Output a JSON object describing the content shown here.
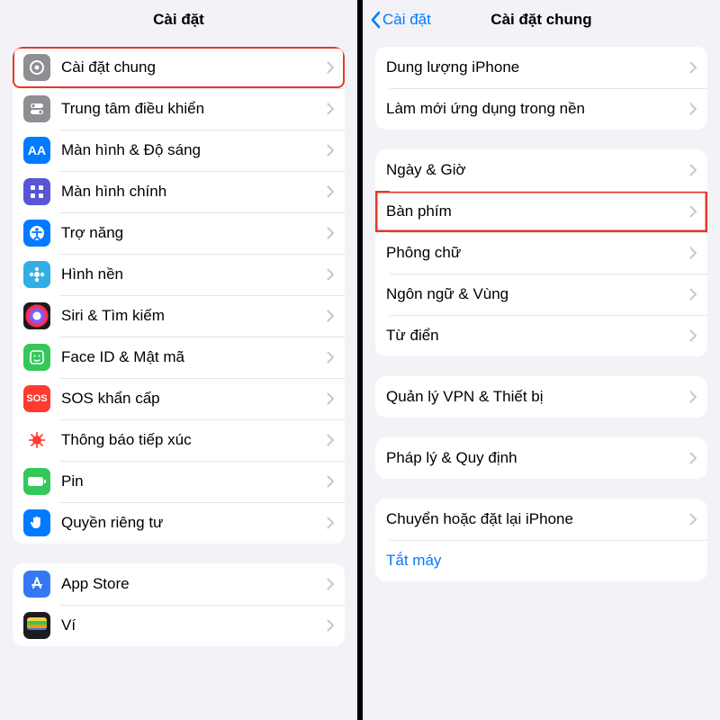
{
  "left": {
    "title": "Cài đặt",
    "group1": [
      {
        "key": "general",
        "label": "Cài đặt chung",
        "iconClass": "bg-grey",
        "glyph": "gear",
        "highlight": true
      },
      {
        "key": "control",
        "label": "Trung tâm điều khiển",
        "iconClass": "bg-grey2",
        "glyph": "switches"
      },
      {
        "key": "display",
        "label": "Màn hình & Độ sáng",
        "iconClass": "bg-blue",
        "glyph": "AA"
      },
      {
        "key": "home",
        "label": "Màn hình chính",
        "iconClass": "bg-indigo",
        "glyph": "grid"
      },
      {
        "key": "access",
        "label": "Trợ năng",
        "iconClass": "bg-blue",
        "glyph": "access"
      },
      {
        "key": "wall",
        "label": "Hình nền",
        "iconClass": "bg-cyan",
        "glyph": "flower"
      },
      {
        "key": "siri",
        "label": "Siri & Tìm kiếm",
        "iconClass": "siri-icon",
        "glyph": ""
      },
      {
        "key": "face",
        "label": "Face ID & Mật mã",
        "iconClass": "bg-green",
        "glyph": "face"
      },
      {
        "key": "sos",
        "label": "SOS khẩn cấp",
        "iconClass": "bg-red",
        "glyph": "SOS"
      },
      {
        "key": "covid",
        "label": "Thông báo tiếp xúc",
        "iconClass": "covid-icon",
        "glyph": "covid"
      },
      {
        "key": "batt",
        "label": "Pin",
        "iconClass": "bg-green",
        "glyph": "battery"
      },
      {
        "key": "priv",
        "label": "Quyền riêng tư",
        "iconClass": "bg-hand",
        "glyph": "hand"
      }
    ],
    "group2": [
      {
        "key": "appstore",
        "label": "App Store",
        "iconClass": "bg-blue2",
        "glyph": "appstore"
      },
      {
        "key": "wallet",
        "label": "Ví",
        "iconClass": "wallet-icon",
        "glyph": ""
      }
    ]
  },
  "right": {
    "back": "Cài đặt",
    "title": "Cài đặt chung",
    "group1": [
      {
        "key": "storage",
        "label": "Dung lượng iPhone"
      },
      {
        "key": "bgrefresh",
        "label": "Làm mới ứng dụng trong nền"
      }
    ],
    "group2": [
      {
        "key": "date",
        "label": "Ngày & Giờ"
      },
      {
        "key": "keyboard",
        "label": "Bàn phím",
        "highlight": true
      },
      {
        "key": "fonts",
        "label": "Phông chữ"
      },
      {
        "key": "lang",
        "label": "Ngôn ngữ & Vùng"
      },
      {
        "key": "dict",
        "label": "Từ điển"
      }
    ],
    "group3": [
      {
        "key": "vpn",
        "label": "Quản lý VPN & Thiết bị"
      }
    ],
    "group4": [
      {
        "key": "legal",
        "label": "Pháp lý & Quy định"
      }
    ],
    "group5": [
      {
        "key": "reset",
        "label": "Chuyển hoặc đặt lại iPhone"
      },
      {
        "key": "shutdown",
        "label": "Tắt máy",
        "link": true,
        "noChevron": true
      }
    ]
  }
}
